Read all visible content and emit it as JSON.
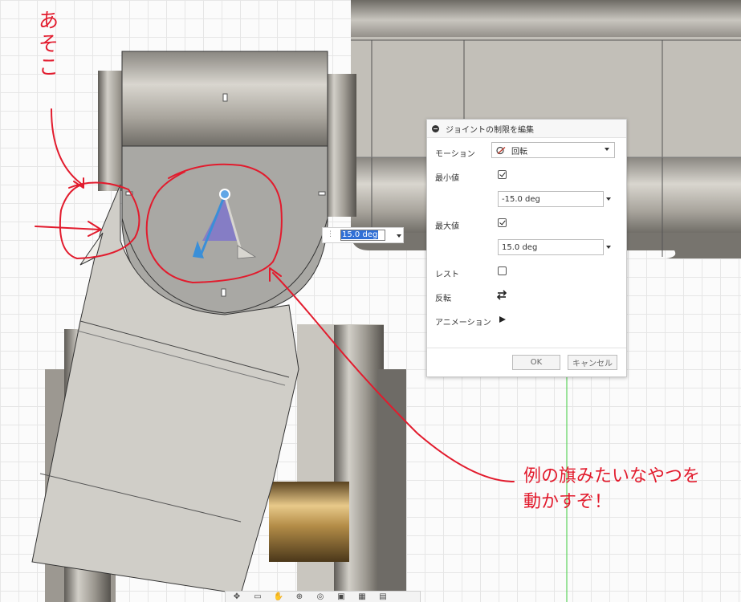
{
  "dialog": {
    "title": "ジョイントの制限を編集",
    "motion_label": "モーション",
    "motion_value": "回転",
    "min_label": "最小値",
    "min_checked": true,
    "min_value": "-15.0 deg",
    "max_label": "最大値",
    "max_checked": true,
    "max_value": "15.0 deg",
    "rest_label": "レスト",
    "rest_checked": false,
    "flip_label": "反転",
    "animation_label": "アニメーション",
    "ok_label": "OK",
    "cancel_label": "キャンセル"
  },
  "canvas_input": {
    "value": "15.0 deg"
  },
  "annotations": {
    "there": "あそこ",
    "message_line1": "例の旗みたいなやつを",
    "message_line2": "動かすぞ！"
  },
  "icons": {
    "collapse": "collapse-icon",
    "revolute": "revolute-joint-icon",
    "flip": "flip-arrows-icon",
    "play": "play-icon",
    "toolbar": [
      "orbit-icon",
      "look-at-icon",
      "pan-icon",
      "zoom-icon",
      "fit-icon",
      "display-mode-icon",
      "grid-icon",
      "viewports-icon"
    ]
  },
  "colors": {
    "annotation": "#e21b2d",
    "selection": "#2f6fd6",
    "joint_blue": "#3a8fd8",
    "joint_purple": "#7a6fd0",
    "axis_green": "#5ed35e"
  }
}
